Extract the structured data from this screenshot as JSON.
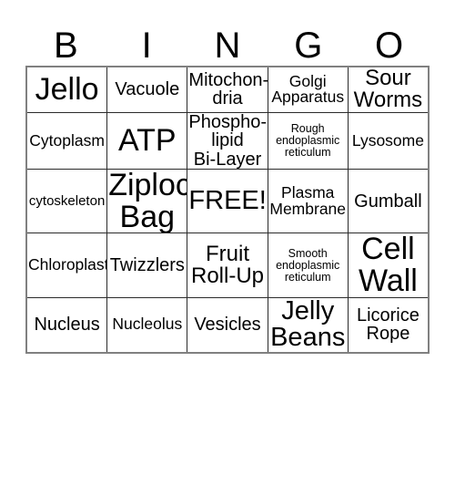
{
  "header": {
    "letters": [
      "B",
      "I",
      "N",
      "G",
      "O"
    ]
  },
  "grid": {
    "rows": [
      [
        {
          "text": "Jello",
          "size": "sz-xxl"
        },
        {
          "text": "Vacuole",
          "size": "sz-ml"
        },
        {
          "text": "Mitochon-\ndria",
          "size": "sz-ml"
        },
        {
          "text": "Golgi\nApparatus",
          "size": "sz-m"
        },
        {
          "text": "Sour\nWorms",
          "size": "sz-l"
        }
      ],
      [
        {
          "text": "Cytoplasm",
          "size": "sz-m"
        },
        {
          "text": "ATP",
          "size": "sz-xxl"
        },
        {
          "text": "Phospho-\nlipid\nBi-Layer",
          "size": "sz-ml"
        },
        {
          "text": "Rough\nendoplasmic\nreticulum",
          "size": "sz-xs"
        },
        {
          "text": "Lysosome",
          "size": "sz-m"
        }
      ],
      [
        {
          "text": "cytoskeleton",
          "size": "sz-s"
        },
        {
          "text": "Ziploc\nBag",
          "size": "sz-xxl"
        },
        {
          "text": "FREE!",
          "size": "sz-xl"
        },
        {
          "text": "Plasma\nMembrane",
          "size": "sz-m"
        },
        {
          "text": "Gumball",
          "size": "sz-ml"
        }
      ],
      [
        {
          "text": "Chloroplast",
          "size": "sz-m"
        },
        {
          "text": "Twizzlers",
          "size": "sz-ml"
        },
        {
          "text": "Fruit\nRoll-Up",
          "size": "sz-l"
        },
        {
          "text": "Smooth\nendoplasmic\nreticulum",
          "size": "sz-xs"
        },
        {
          "text": "Cell\nWall",
          "size": "sz-xxl"
        }
      ],
      [
        {
          "text": "Nucleus",
          "size": "sz-ml"
        },
        {
          "text": "Nucleolus",
          "size": "sz-m"
        },
        {
          "text": "Vesicles",
          "size": "sz-ml"
        },
        {
          "text": "Jelly\nBeans",
          "size": "sz-xl"
        },
        {
          "text": "Licorice\nRope",
          "size": "sz-ml"
        }
      ]
    ]
  },
  "colors": {
    "background": "#ffffff",
    "text": "#000000",
    "outer_border": "#808080",
    "inner_border": "#2b2b2b"
  }
}
